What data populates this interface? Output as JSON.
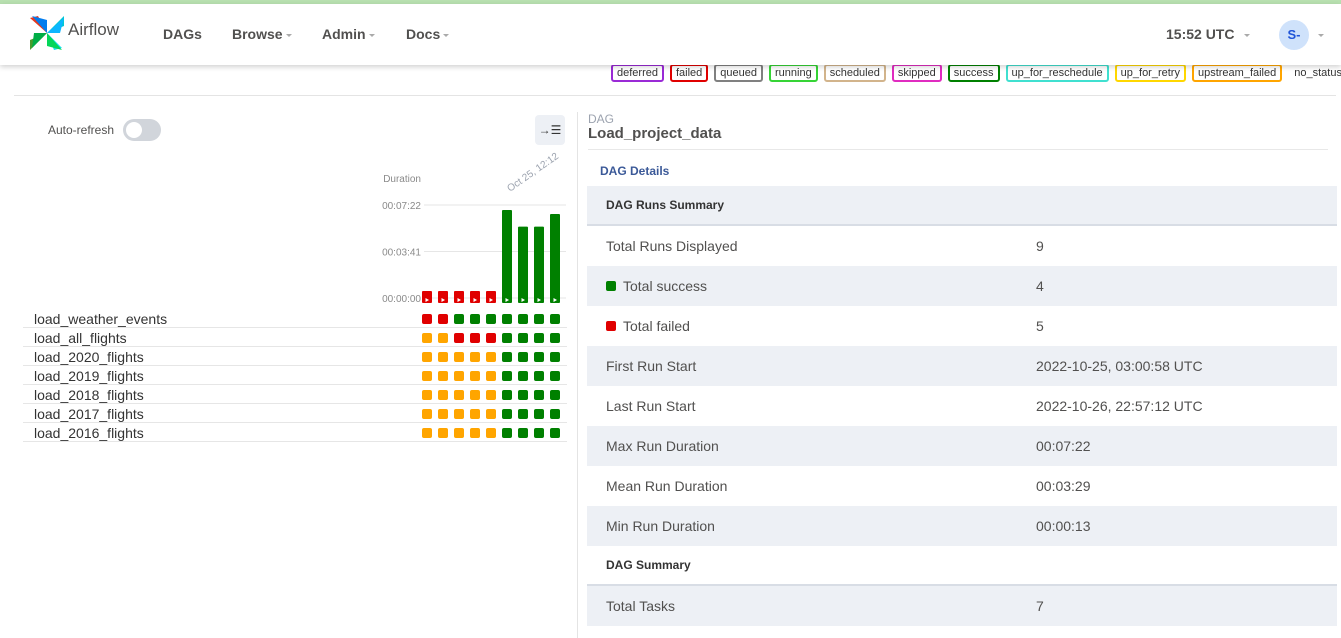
{
  "app": {
    "brand": "Airflow"
  },
  "nav": {
    "dags": "DAGs",
    "browse": "Browse",
    "admin": "Admin",
    "docs": "Docs",
    "clock": "15:52 UTC",
    "user_initials": "S-"
  },
  "legend": {
    "states": [
      {
        "label": "deferred",
        "color": "#9a2ad6"
      },
      {
        "label": "failed",
        "color": "#e00000"
      },
      {
        "label": "queued",
        "color": "#808080"
      },
      {
        "label": "running",
        "color": "#36d436"
      },
      {
        "label": "scheduled",
        "color": "#d2b48c"
      },
      {
        "label": "skipped",
        "color": "#e02cc0"
      },
      {
        "label": "success",
        "color": "#008000"
      },
      {
        "label": "up_for_reschedule",
        "color": "#40e0d0"
      },
      {
        "label": "up_for_retry",
        "color": "#ffd700"
      },
      {
        "label": "upstream_failed",
        "color": "#ffa500"
      },
      {
        "label": "no_status",
        "color": ""
      }
    ]
  },
  "grid": {
    "auto_refresh_label": "Auto-refresh",
    "auto_refresh_on": false,
    "duration_label": "Duration",
    "y_ticks": [
      "00:07:22",
      "00:03:41",
      "00:00:00"
    ],
    "date_label": "Oct 25, 12:12",
    "runs": [
      {
        "state": "failed",
        "duration_sec": 13
      },
      {
        "state": "failed",
        "duration_sec": 13
      },
      {
        "state": "failed",
        "duration_sec": 18
      },
      {
        "state": "failed",
        "duration_sec": 20
      },
      {
        "state": "failed",
        "duration_sec": 17
      },
      {
        "state": "success",
        "duration_sec": 442
      },
      {
        "state": "success",
        "duration_sec": 363
      },
      {
        "state": "success",
        "duration_sec": 363
      },
      {
        "state": "success",
        "duration_sec": 423
      }
    ],
    "tasks": [
      {
        "name": "load_weather_events",
        "states": [
          "failed",
          "failed",
          "success",
          "success",
          "success",
          "success",
          "success",
          "success",
          "success"
        ]
      },
      {
        "name": "load_all_flights",
        "states": [
          "upstream_failed",
          "upstream_failed",
          "failed",
          "failed",
          "failed",
          "success",
          "success",
          "success",
          "success"
        ]
      },
      {
        "name": "load_2020_flights",
        "states": [
          "upstream_failed",
          "upstream_failed",
          "upstream_failed",
          "upstream_failed",
          "upstream_failed",
          "success",
          "success",
          "success",
          "success"
        ]
      },
      {
        "name": "load_2019_flights",
        "states": [
          "upstream_failed",
          "upstream_failed",
          "upstream_failed",
          "upstream_failed",
          "upstream_failed",
          "success",
          "success",
          "success",
          "success"
        ]
      },
      {
        "name": "load_2018_flights",
        "states": [
          "upstream_failed",
          "upstream_failed",
          "upstream_failed",
          "upstream_failed",
          "upstream_failed",
          "success",
          "success",
          "success",
          "success"
        ]
      },
      {
        "name": "load_2017_flights",
        "states": [
          "upstream_failed",
          "upstream_failed",
          "upstream_failed",
          "upstream_failed",
          "upstream_failed",
          "success",
          "success",
          "success",
          "success"
        ]
      },
      {
        "name": "load_2016_flights",
        "states": [
          "upstream_failed",
          "upstream_failed",
          "upstream_failed",
          "upstream_failed",
          "upstream_failed",
          "success",
          "success",
          "success",
          "success"
        ]
      }
    ]
  },
  "details": {
    "dag_label": "DAG",
    "dag_id": "Load_project_data",
    "tab": "DAG Details",
    "runs_summary_header": "DAG Runs Summary",
    "rows": [
      {
        "label": "Total Runs Displayed",
        "value": "9"
      },
      {
        "label": "Total success",
        "value": "4",
        "icon_color": "#008000"
      },
      {
        "label": "Total failed",
        "value": "5",
        "icon_color": "#e00000"
      },
      {
        "label": "First Run Start",
        "value": "2022-10-25, 03:00:58 UTC"
      },
      {
        "label": "Last Run Start",
        "value": "2022-10-26, 22:57:12 UTC"
      },
      {
        "label": "Max Run Duration",
        "value": "00:07:22"
      },
      {
        "label": "Mean Run Duration",
        "value": "00:03:29"
      },
      {
        "label": "Min Run Duration",
        "value": "00:00:13"
      }
    ],
    "dag_summary_header": "DAG Summary",
    "summary_rows": [
      {
        "label": "Total Tasks",
        "value": "7"
      }
    ]
  }
}
